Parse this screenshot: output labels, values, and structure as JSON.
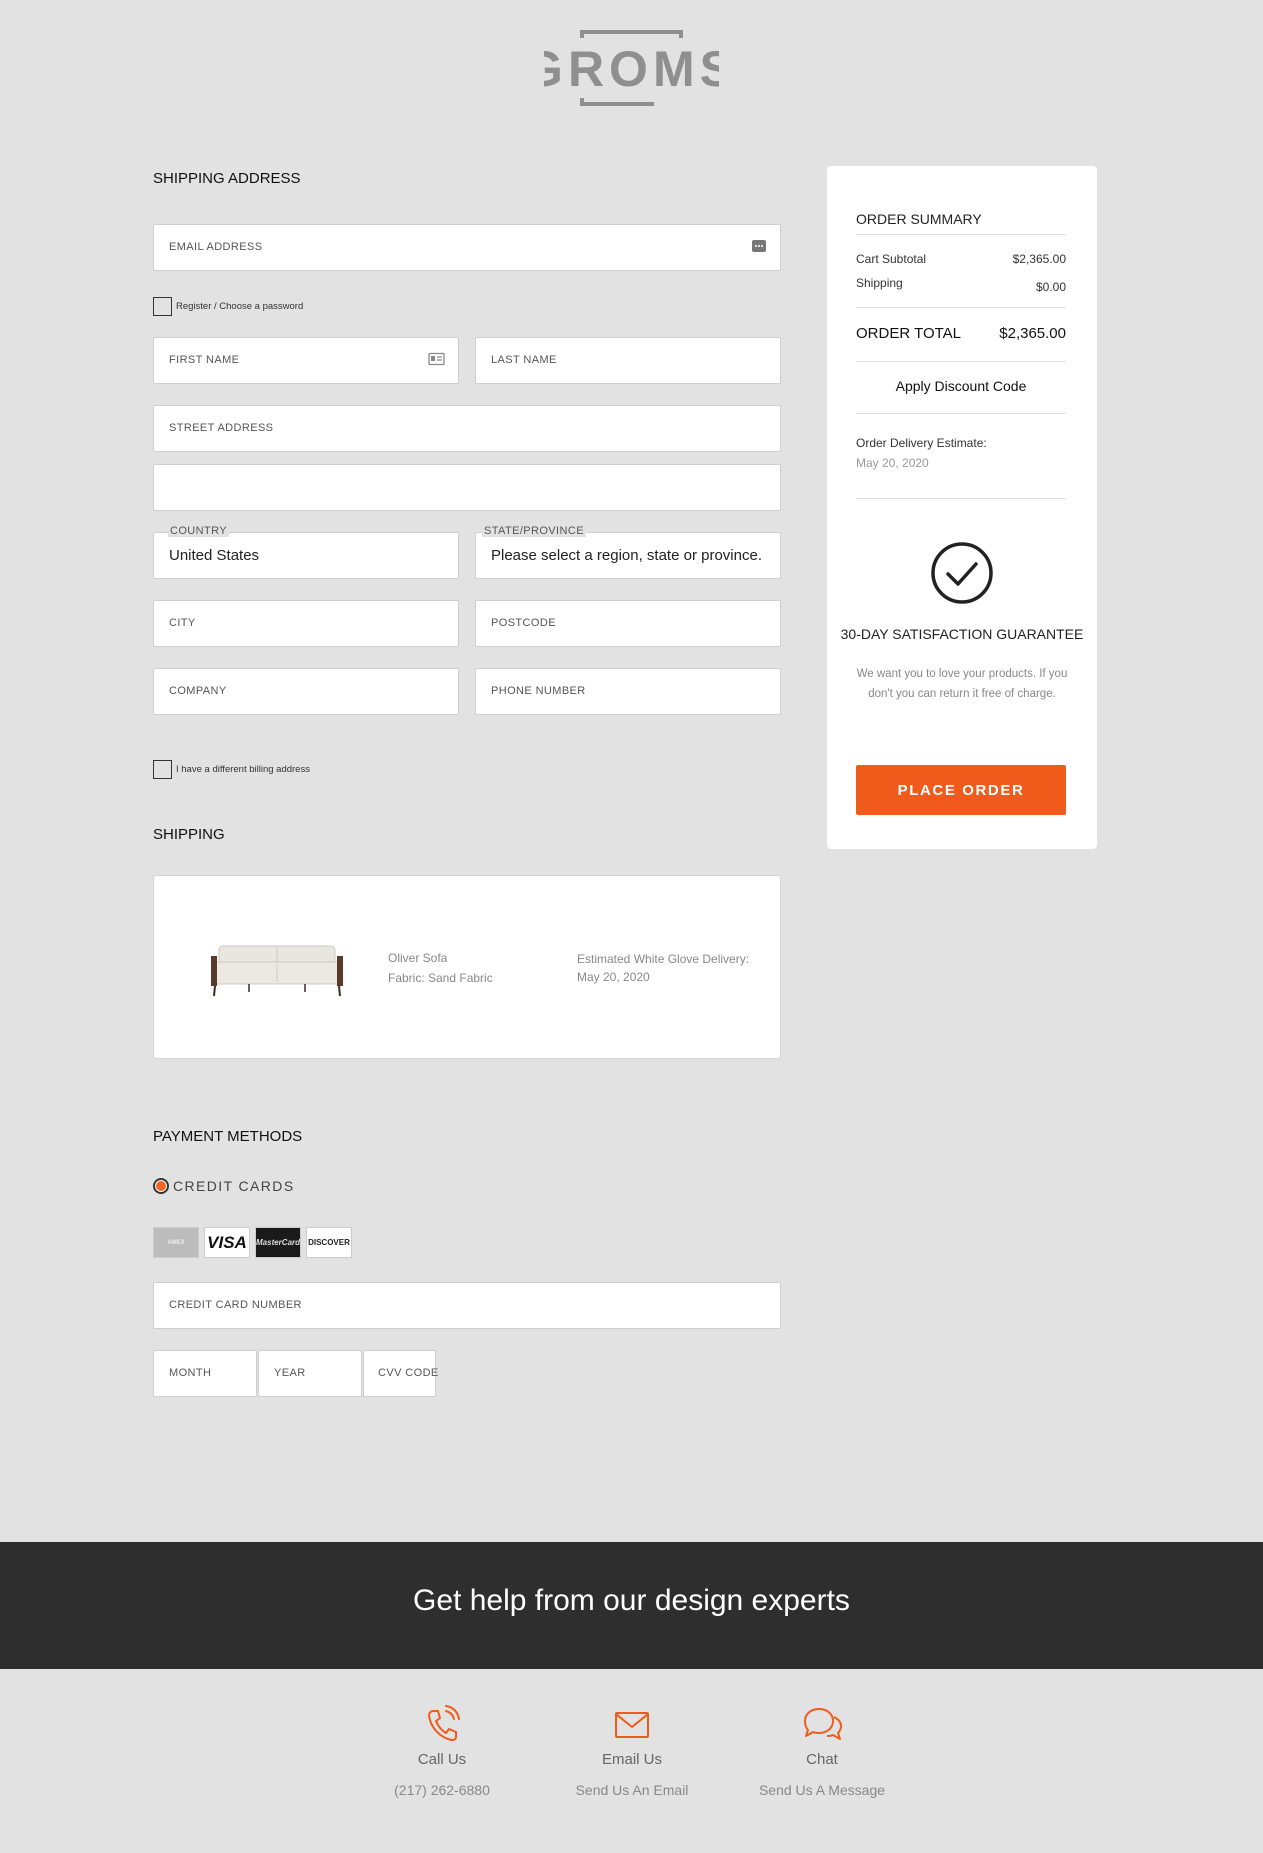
{
  "brand": {
    "logo_text": "GROMS",
    "accent": "#f05a1a",
    "logo_color": "#8f8f8f"
  },
  "shipping_address": {
    "title": "SHIPPING ADDRESS",
    "email_placeholder": "EMAIL ADDRESS",
    "register_label": "Register / Choose a password",
    "first_name_placeholder": "FIRST NAME",
    "last_name_placeholder": "LAST NAME",
    "street_placeholder": "STREET ADDRESS",
    "street2_placeholder": "",
    "country_label": "COUNTRY",
    "country_value": "United States",
    "state_label": "STATE/PROVINCE",
    "state_value": "Please select a region, state or province.",
    "city_placeholder": "CITY",
    "postcode_placeholder": "POSTCODE",
    "company_placeholder": "COMPANY",
    "phone_placeholder": "PHONE NUMBER",
    "billing_label": "I have a different billing address"
  },
  "shipping": {
    "title": "SHIPPING",
    "product_name": "Oliver Sofa",
    "product_fabric": "Fabric: Sand Fabric",
    "delivery_label": "Estimated White Glove Delivery:",
    "delivery_date": "May 20, 2020"
  },
  "payment": {
    "title": "PAYMENT METHODS",
    "method_label": "CREDIT CARDS",
    "card_brands": [
      "AMEX",
      "VISA",
      "MasterCard",
      "DISCOVER"
    ],
    "card_number_placeholder": "CREDIT CARD NUMBER",
    "month_placeholder": "MONTH",
    "year_placeholder": "YEAR",
    "cvv_placeholder": "CVV CODE"
  },
  "summary": {
    "title": "ORDER SUMMARY",
    "subtotal_label": "Cart Subtotal",
    "subtotal_value": "$2,365.00",
    "shipping_label": "Shipping",
    "shipping_value": "$0.00",
    "total_label": "ORDER TOTAL",
    "total_value": "$2,365.00",
    "discount_label": "Apply Discount Code",
    "estimate_label": "Order Delivery Estimate:",
    "estimate_value": "May 20, 2020",
    "guarantee_title": "30-DAY SATISFACTION GUARANTEE",
    "guarantee_text": "We want you to love your products. If you don't you can return it free of charge.",
    "place_order_label": "PLACE ORDER"
  },
  "help": {
    "heading": "Get help from our design experts",
    "contacts": [
      {
        "label": "Call Us",
        "sub": "(217) 262-6880",
        "icon": "phone-icon"
      },
      {
        "label": "Email Us",
        "sub": "Send Us An Email",
        "icon": "envelope-icon"
      },
      {
        "label": "Chat",
        "sub": "Send Us A Message",
        "icon": "chat-icon"
      }
    ]
  }
}
